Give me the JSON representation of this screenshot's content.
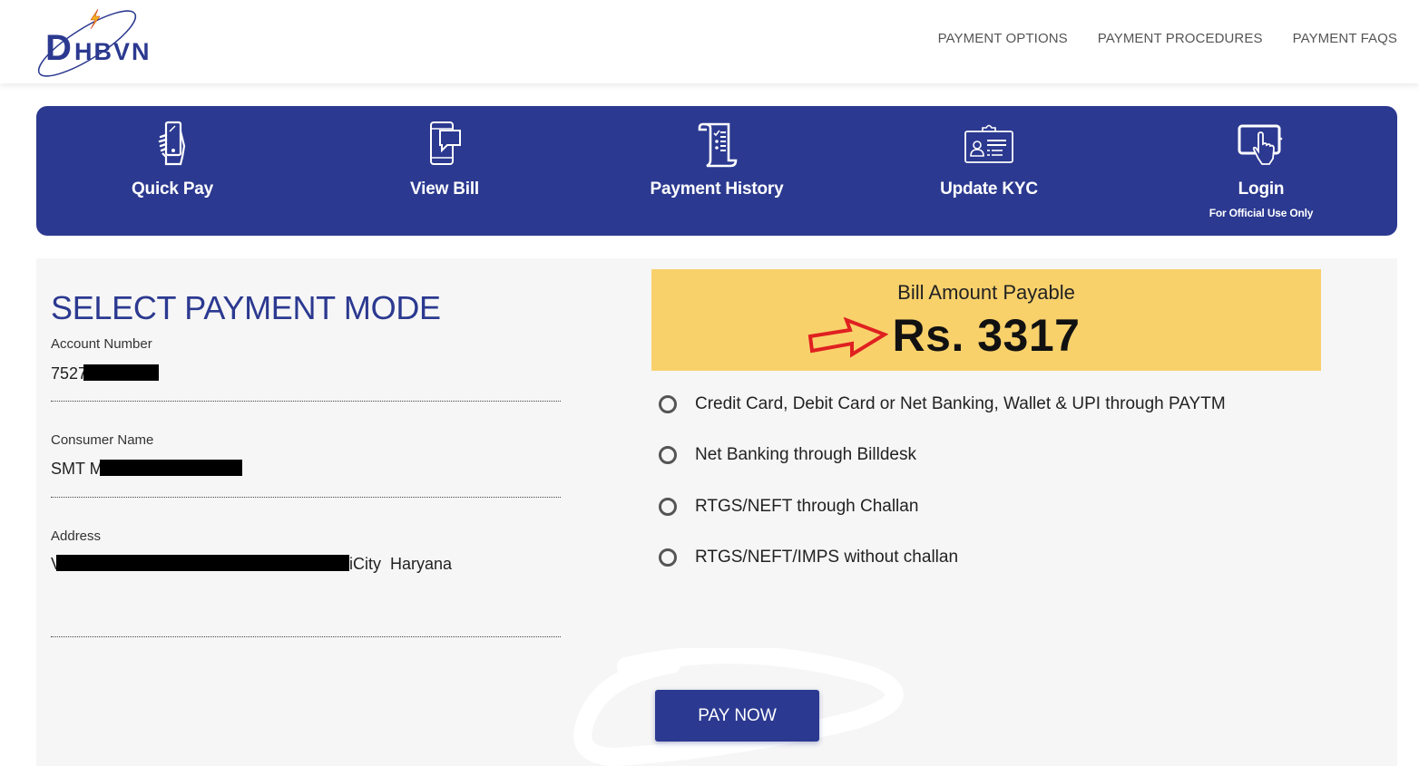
{
  "header": {
    "logo_text": "DHBVN",
    "nav": [
      {
        "label": "PAYMENT OPTIONS"
      },
      {
        "label": "PAYMENT PROCEDURES"
      },
      {
        "label": "PAYMENT FAQS"
      }
    ]
  },
  "tiles": [
    {
      "label": "Quick Pay",
      "icon": "hand-phone-icon"
    },
    {
      "label": "View Bill",
      "icon": "phone-chat-icon"
    },
    {
      "label": "Payment History",
      "icon": "scroll-list-icon"
    },
    {
      "label": "Update KYC",
      "icon": "id-card-icon"
    },
    {
      "label": "Login",
      "sub": "For Official Use Only",
      "icon": "tablet-touch-icon"
    }
  ],
  "form": {
    "title": "SELECT PAYMENT MODE",
    "account_label": "Account Number",
    "account_value": "7527",
    "name_label": "Consumer Name",
    "name_value": "SMT M",
    "address_label": "Address",
    "address_prefix": "V",
    "address_suffix": "iCity  Haryana"
  },
  "bill": {
    "label": "Bill Amount Payable",
    "amount": "Rs. 3317"
  },
  "payment_options": [
    {
      "label": "Credit Card, Debit Card or Net Banking, Wallet & UPI through PAYTM",
      "selected": false
    },
    {
      "label": "Net Banking through Billdesk",
      "selected": false
    },
    {
      "label": "RTGS/NEFT through Challan",
      "selected": false
    },
    {
      "label": "RTGS/NEFT/IMPS without challan",
      "selected": false
    }
  ],
  "pay_button": "PAY NOW",
  "colors": {
    "brand_blue": "#2b3990",
    "bill_yellow": "#f8d16b",
    "arrow_red": "#e02020"
  }
}
